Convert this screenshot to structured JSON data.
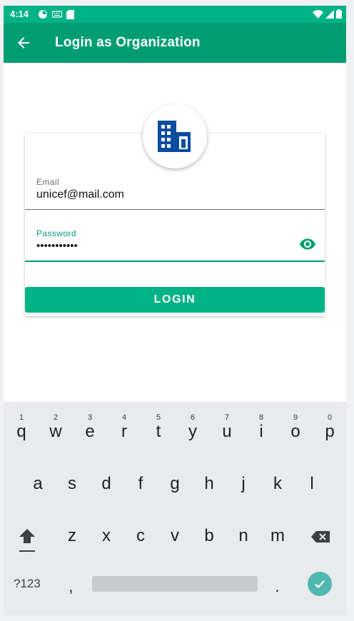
{
  "status_bar": {
    "time": "4:14",
    "icons": [
      "pie-icon",
      "keyboard-icon",
      "sdcard-icon"
    ],
    "right_icons": [
      "wifi-icon",
      "signal-icon",
      "battery-icon"
    ]
  },
  "app_bar": {
    "title": "Login as Organization",
    "back_icon": "arrow-left-icon"
  },
  "logo": {
    "icon": "building-icon",
    "color": "#0d4d9e"
  },
  "form": {
    "email_label": "Email",
    "email_value": "unicef@mail.com",
    "password_label": "Password",
    "password_value": "•••••••••••",
    "visibility_icon": "eye-icon",
    "login_label": "LOGIN"
  },
  "colors": {
    "primary": "#00b386",
    "primary_dark": "#009d73",
    "keyboard_bg": "#e8eaed"
  },
  "keyboard": {
    "row1": [
      {
        "ch": "q",
        "hint": "1"
      },
      {
        "ch": "w",
        "hint": "2"
      },
      {
        "ch": "e",
        "hint": "3"
      },
      {
        "ch": "r",
        "hint": "4"
      },
      {
        "ch": "t",
        "hint": "5"
      },
      {
        "ch": "y",
        "hint": "6"
      },
      {
        "ch": "u",
        "hint": "7"
      },
      {
        "ch": "i",
        "hint": "8"
      },
      {
        "ch": "o",
        "hint": "9"
      },
      {
        "ch": "p",
        "hint": "0"
      }
    ],
    "row2": [
      "a",
      "s",
      "d",
      "f",
      "g",
      "h",
      "j",
      "k",
      "l"
    ],
    "row3": [
      "z",
      "x",
      "c",
      "v",
      "b",
      "n",
      "m"
    ],
    "symbols_label": "?123",
    "comma_label": ",",
    "period_label": ".",
    "shift_icon": "shift-icon",
    "backspace_icon": "backspace-icon",
    "enter_icon": "check-icon"
  }
}
